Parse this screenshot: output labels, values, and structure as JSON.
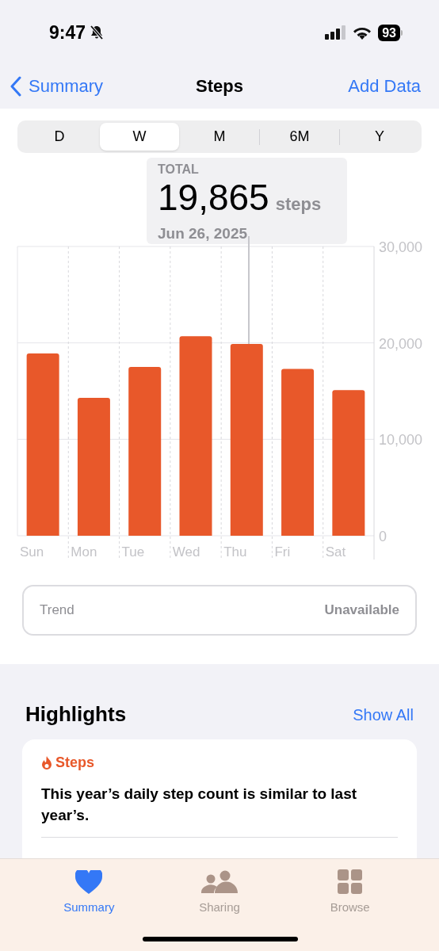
{
  "status_bar": {
    "time": "9:47",
    "battery": "93"
  },
  "nav": {
    "back": "Summary",
    "title": "Steps",
    "action": "Add Data"
  },
  "ranges": [
    {
      "label": "D",
      "selected": false
    },
    {
      "label": "W",
      "selected": true
    },
    {
      "label": "M",
      "selected": false
    },
    {
      "label": "6M",
      "selected": false
    },
    {
      "label": "Y",
      "selected": false
    }
  ],
  "tooltip": {
    "label": "TOTAL",
    "value": "19,865",
    "unit": "steps",
    "date": "Jun 26, 2025"
  },
  "chart_data": {
    "type": "bar",
    "categories": [
      "Sun",
      "Mon",
      "Tue",
      "Wed",
      "Thu",
      "Fri",
      "Sat"
    ],
    "series": [
      {
        "color": "#e8582a",
        "values": [
          18900,
          14300,
          17500,
          20700,
          19900,
          17300,
          15100
        ]
      }
    ],
    "ylim": [
      0,
      30000
    ],
    "yticks": [
      {
        "value": 0,
        "label": "0"
      },
      {
        "value": 10000,
        "label": "10,000"
      },
      {
        "value": 20000,
        "label": "20,000"
      },
      {
        "value": 30000,
        "label": "30,000"
      }
    ]
  },
  "trend": {
    "label": "Trend",
    "value": "Unavailable"
  },
  "highlights": {
    "title": "Highlights",
    "action": "Show All",
    "card": {
      "category": "Steps",
      "text": "This year’s daily step count is similar to last year’s."
    }
  },
  "tab_bar": [
    {
      "label": "Summary",
      "kind": "heart",
      "selected": true
    },
    {
      "label": "Sharing",
      "kind": "people",
      "selected": false
    },
    {
      "label": "Browse",
      "kind": "grid",
      "selected": false
    }
  ]
}
